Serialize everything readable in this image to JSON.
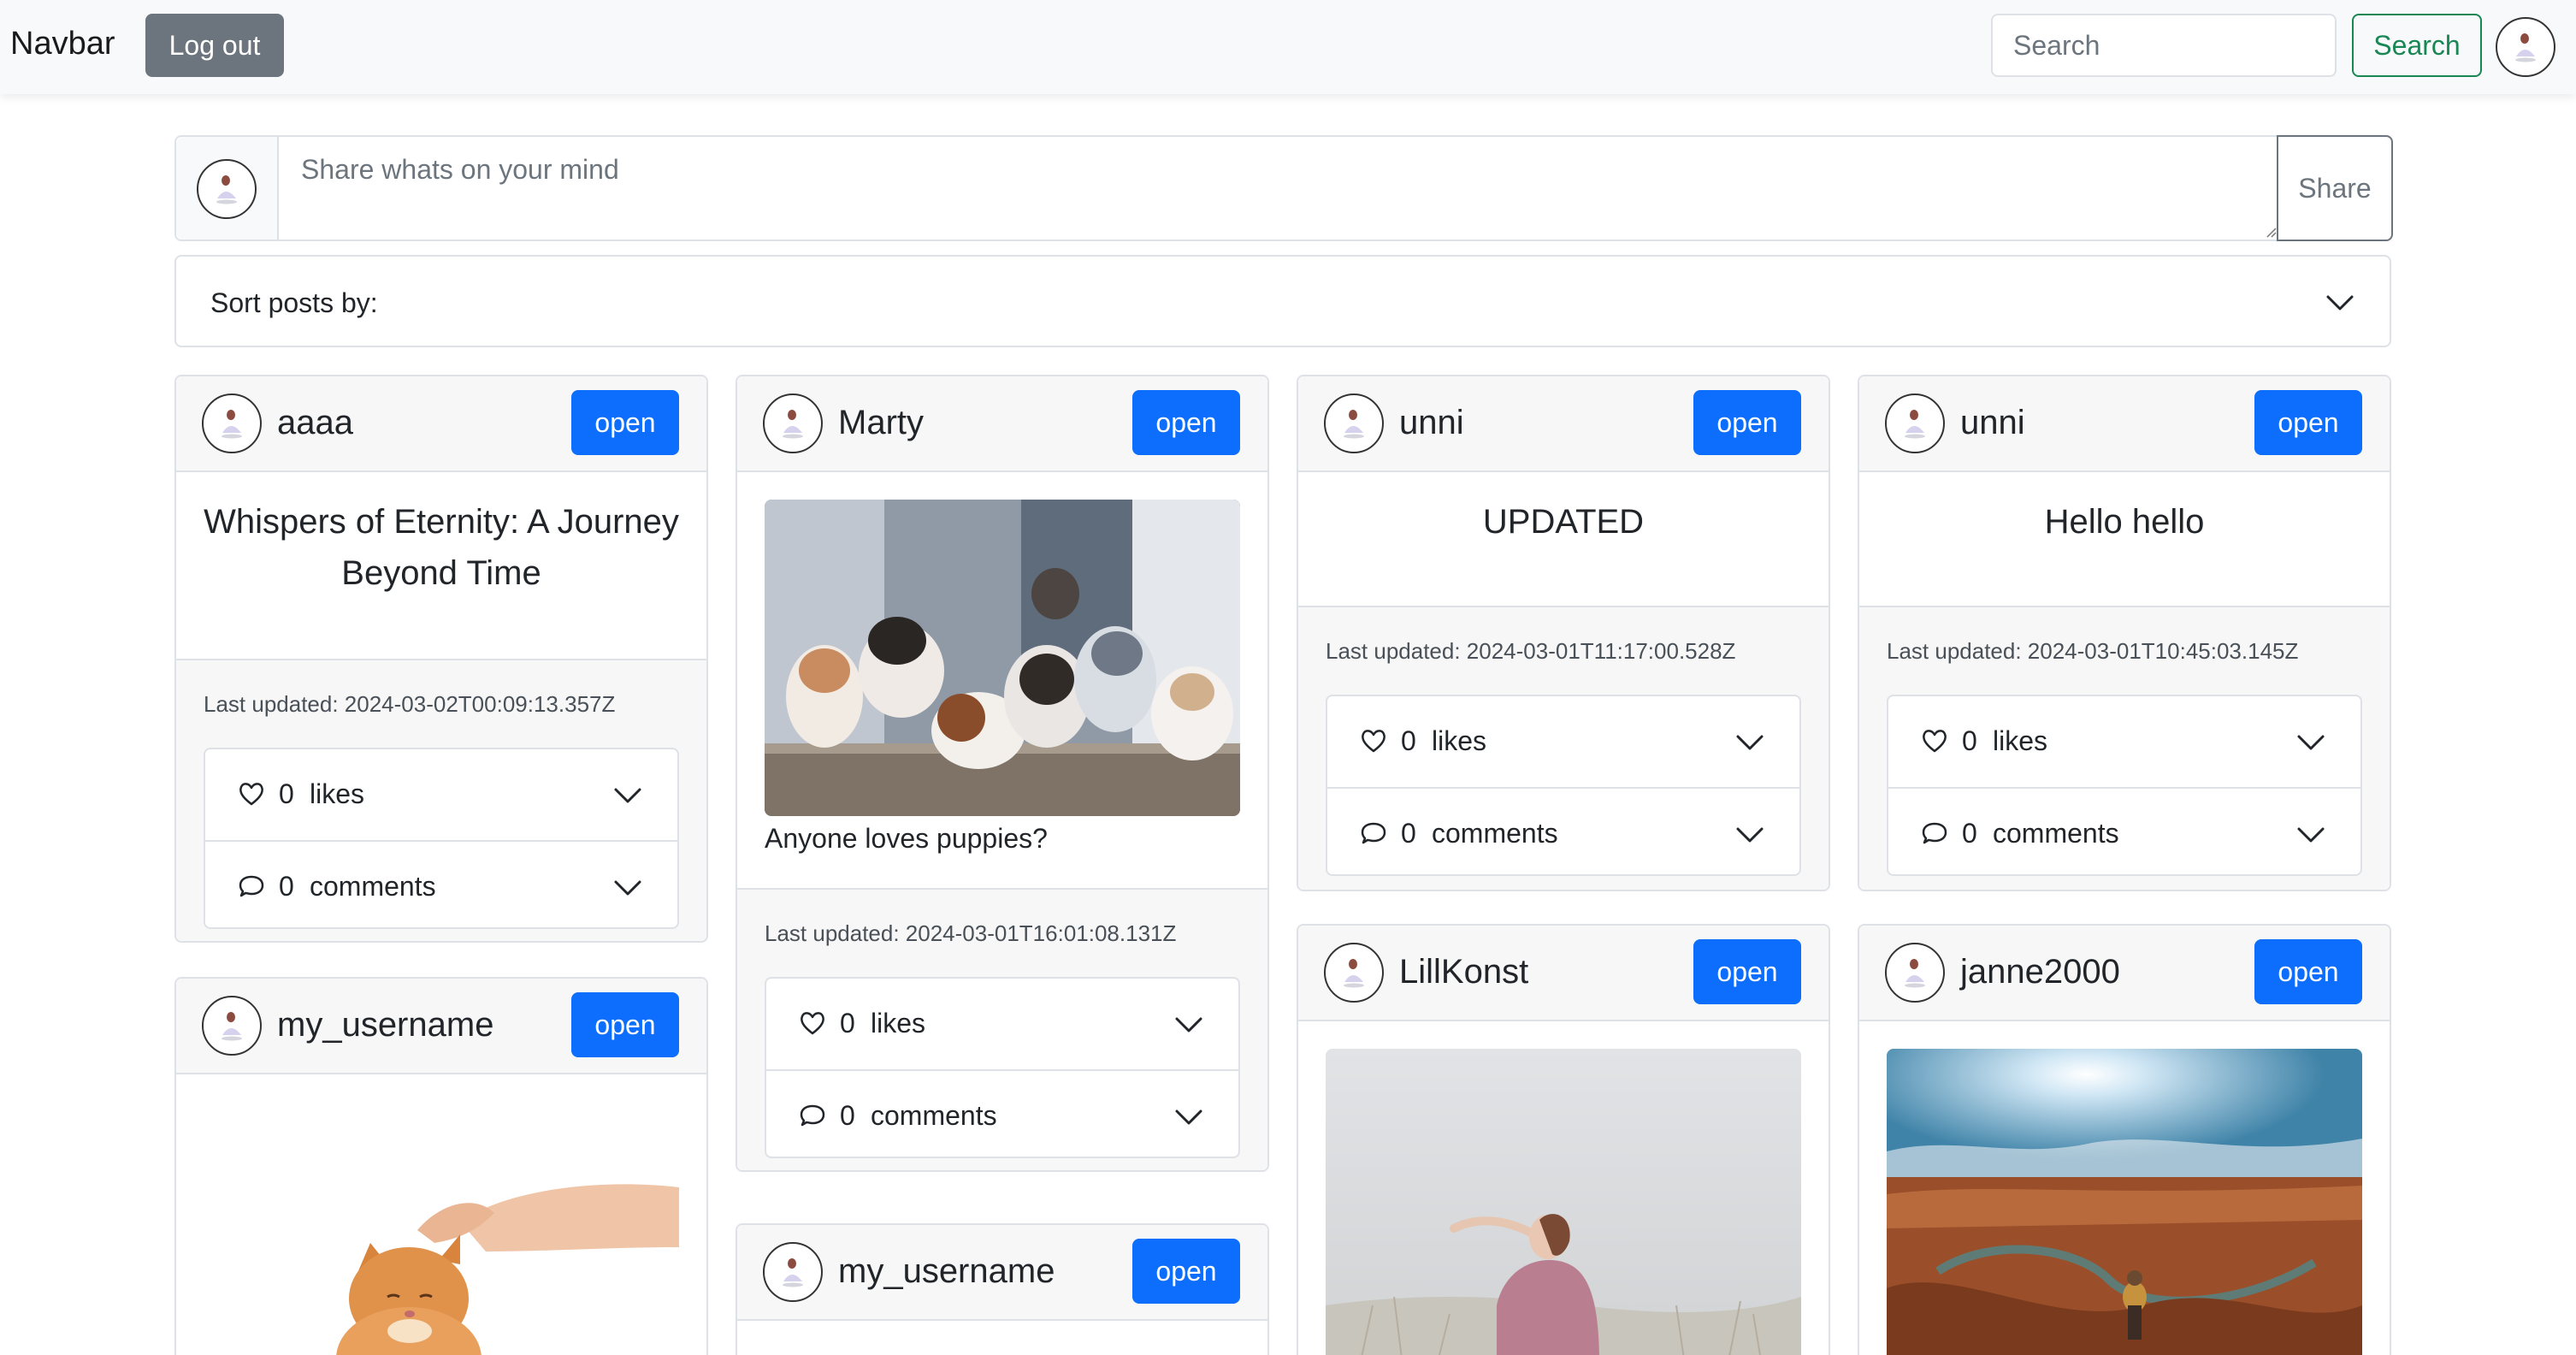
{
  "navbar": {
    "brand": "Navbar",
    "logout_label": "Log out",
    "search_placeholder": "Search",
    "search_button": "Search"
  },
  "composer": {
    "placeholder": "Share whats on your mind",
    "share_label": "Share"
  },
  "sort": {
    "label": "Sort posts by:"
  },
  "posts": [
    {
      "username": "aaaa",
      "open_label": "open",
      "title": "Whispers of Eternity: A Journey Beyond Time",
      "last_updated": "Last updated: 2024-03-02T00:09:13.357Z",
      "likes_count": "0",
      "likes_label": "likes",
      "comments_count": "0",
      "comments_label": "comments"
    },
    {
      "username": "Marty",
      "open_label": "open",
      "caption": "Anyone loves puppies?",
      "image": "puppies-photo",
      "last_updated": "Last updated: 2024-03-01T16:01:08.131Z",
      "likes_count": "0",
      "likes_label": "likes",
      "comments_count": "0",
      "comments_label": "comments"
    },
    {
      "username": "unni",
      "open_label": "open",
      "title": "UPDATED",
      "last_updated": "Last updated: 2024-03-01T11:17:00.528Z",
      "likes_count": "0",
      "likes_label": "likes",
      "comments_count": "0",
      "comments_label": "comments"
    },
    {
      "username": "unni",
      "open_label": "open",
      "title": "Hello hello",
      "last_updated": "Last updated: 2024-03-01T10:45:03.145Z",
      "likes_count": "0",
      "likes_label": "likes",
      "comments_count": "0",
      "comments_label": "comments"
    },
    {
      "username": "my_username",
      "open_label": "open",
      "image": "cat-photo"
    },
    {
      "username": "my_username",
      "open_label": "open"
    },
    {
      "username": "LillKonst",
      "open_label": "open",
      "image": "woman-field-photo"
    },
    {
      "username": "janne2000",
      "open_label": "open",
      "image": "canyon-photo"
    }
  ],
  "colors": {
    "primary": "#0d6efd",
    "secondary": "#6c757d",
    "success": "#198754",
    "navbar_bg": "#f8f9fa",
    "border": "#dee2e6"
  }
}
